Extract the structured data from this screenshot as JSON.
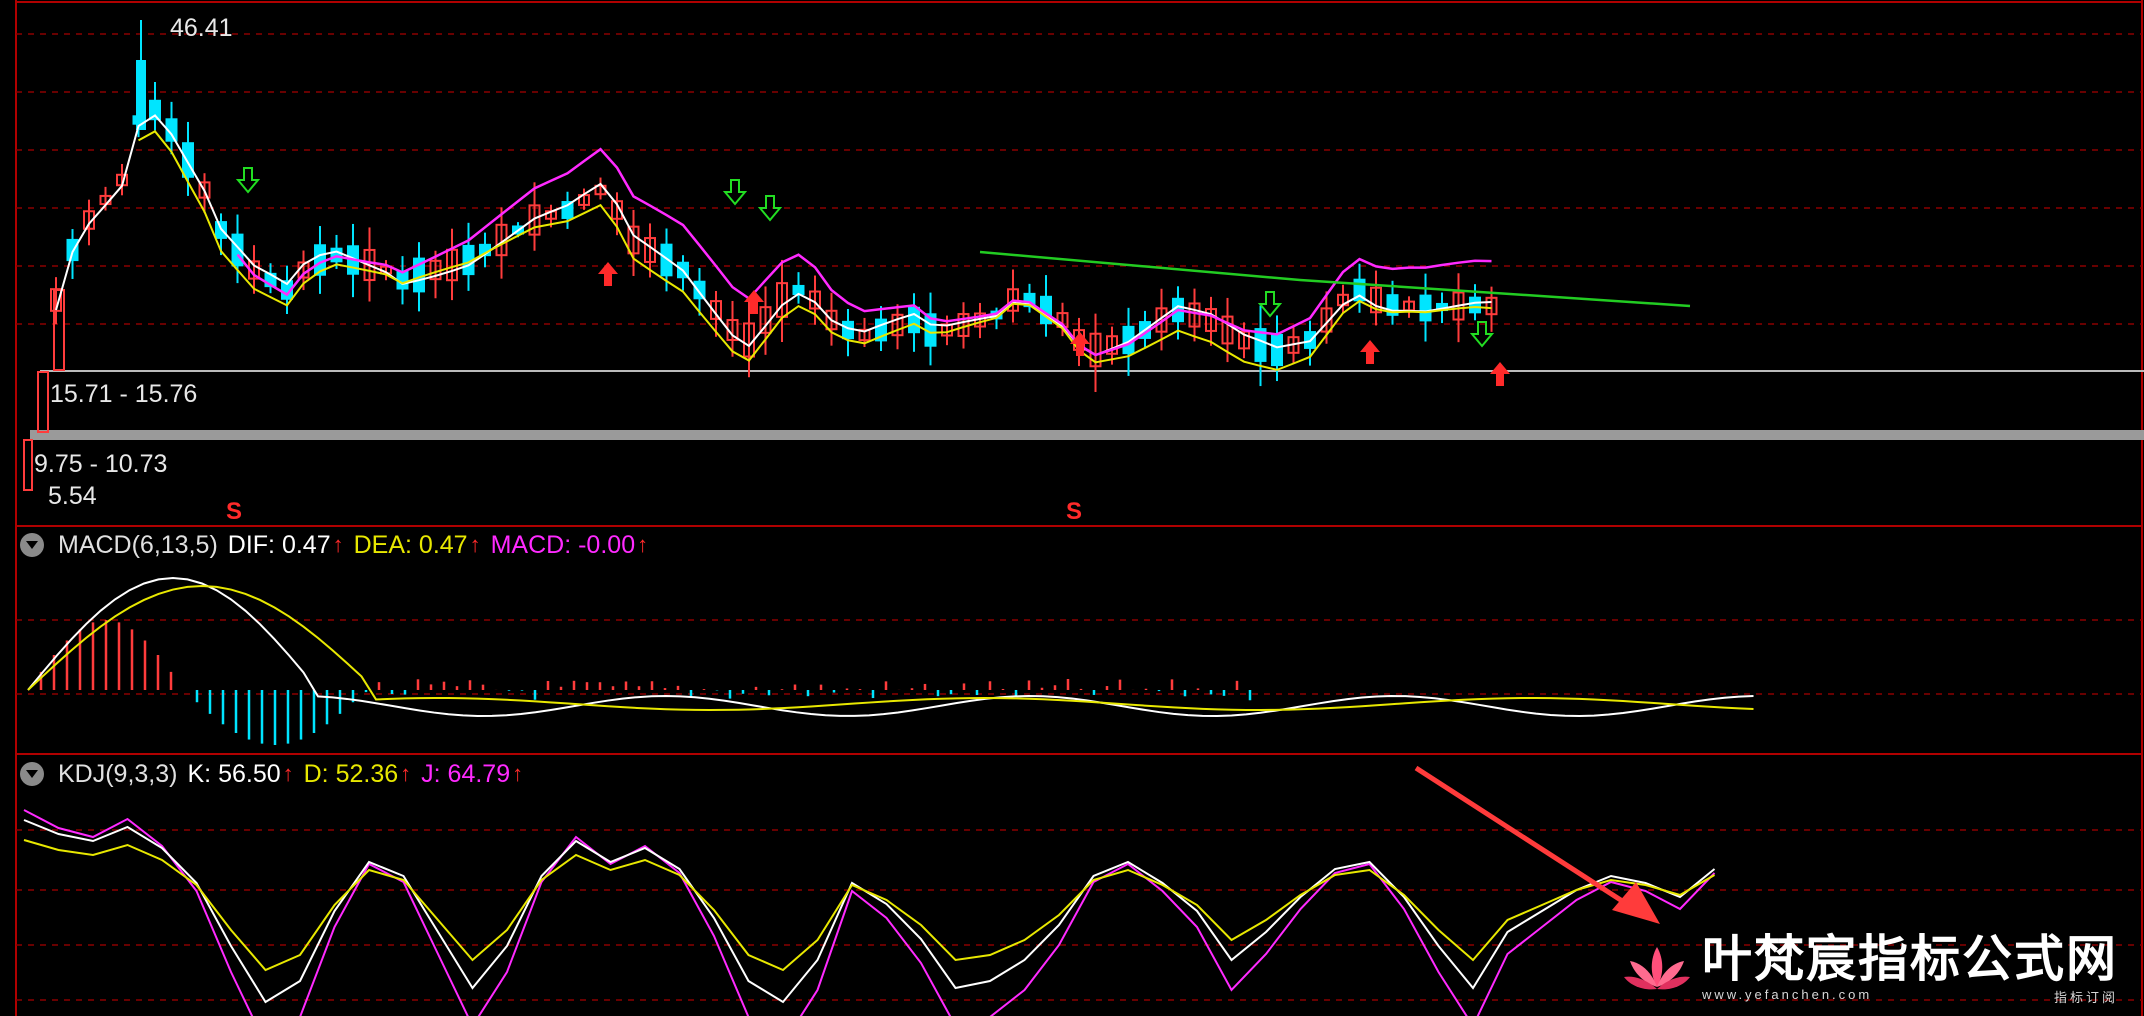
{
  "price_panel": {
    "high_label": "46.41",
    "low_label": "5.54",
    "range_upper": "15.71 - 15.76",
    "range_lower": "9.75 - 10.73",
    "s_markers": [
      "S",
      "S"
    ]
  },
  "macd": {
    "name": "MACD(6,13,5)",
    "dif_label": "DIF:",
    "dif_value": "0.47",
    "dea_label": "DEA:",
    "dea_value": "0.47",
    "macd_label": "MACD:",
    "macd_value": "-0.00",
    "up_arrow": "↑"
  },
  "kdj": {
    "name": "KDJ(9,3,3)",
    "k_label": "K:",
    "k_value": "56.50",
    "d_label": "D:",
    "d_value": "52.36",
    "j_label": "J:",
    "j_value": "64.79",
    "up_arrow": "↑"
  },
  "watermark": {
    "title": "叶梵宸指标公式网",
    "site": "www.yefanchen.com",
    "subtitle": "指标订阅"
  },
  "colors": {
    "background": "#000000",
    "up_candle": "#ff3c3c",
    "down_candle": "#00e5ff",
    "ma_white": "#ffffff",
    "ma_yellow": "#e8e800",
    "ma_magenta": "#ff2aff",
    "ma_green": "#22cc22",
    "grid": "#8b0000"
  },
  "chart_data": [
    {
      "type": "candlestick",
      "title": "",
      "high": 46.41,
      "low": 5.54,
      "price_range_bands": [
        "15.71 - 15.76",
        "9.75 - 10.73"
      ],
      "grid": true
    },
    {
      "type": "line",
      "title": "MACD(6,13,5)",
      "series": [
        {
          "name": "DIF",
          "last": 0.47
        },
        {
          "name": "DEA",
          "last": 0.47
        },
        {
          "name": "MACD",
          "last": -0.0
        }
      ]
    },
    {
      "type": "line",
      "title": "KDJ(9,3,3)",
      "series": [
        {
          "name": "K",
          "last": 56.5
        },
        {
          "name": "D",
          "last": 52.36
        },
        {
          "name": "J",
          "last": 64.79
        }
      ]
    }
  ]
}
